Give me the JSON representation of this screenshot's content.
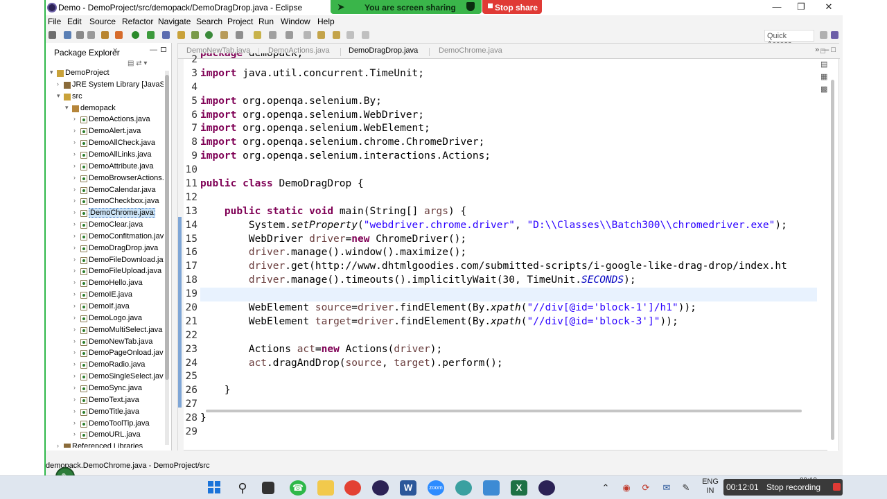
{
  "window": {
    "title": "Demo - DemoProject/src/demopack/DemoDragDrop.java - Eclipse"
  },
  "sharing": {
    "message": "You are screen sharing",
    "stop_label": "Stop share"
  },
  "menu": [
    "File",
    "Edit",
    "Source",
    "Refactor",
    "Navigate",
    "Search",
    "Project",
    "Run",
    "Window",
    "Help"
  ],
  "toolbar": {
    "quick_access": "Quick Access"
  },
  "package_explorer": {
    "title": "Package Explorer",
    "tree": [
      {
        "label": "DemoProject",
        "level": 0,
        "kind": "project"
      },
      {
        "label": "JRE System Library [JavaSE-",
        "level": 1,
        "kind": "library"
      },
      {
        "label": "src",
        "level": 1,
        "kind": "folder"
      },
      {
        "label": "demopack",
        "level": 2,
        "kind": "package"
      },
      {
        "label": "DemoActions.java",
        "level": 3,
        "kind": "file"
      },
      {
        "label": "DemoAlert.java",
        "level": 3,
        "kind": "file"
      },
      {
        "label": "DemoAllCheck.java",
        "level": 3,
        "kind": "file"
      },
      {
        "label": "DemoAllLinks.java",
        "level": 3,
        "kind": "file"
      },
      {
        "label": "DemoAttribute.java",
        "level": 3,
        "kind": "file"
      },
      {
        "label": "DemoBrowserActions.j",
        "level": 3,
        "kind": "file"
      },
      {
        "label": "DemoCalendar.java",
        "level": 3,
        "kind": "file"
      },
      {
        "label": "DemoCheckbox.java",
        "level": 3,
        "kind": "file"
      },
      {
        "label": "DemoChrome.java",
        "level": 3,
        "kind": "file",
        "selected": true
      },
      {
        "label": "DemoClear.java",
        "level": 3,
        "kind": "file"
      },
      {
        "label": "DemoConfitmation.java",
        "level": 3,
        "kind": "file"
      },
      {
        "label": "DemoDragDrop.java",
        "level": 3,
        "kind": "file"
      },
      {
        "label": "DemoFileDownload.jav",
        "level": 3,
        "kind": "file"
      },
      {
        "label": "DemoFileUpload.java",
        "level": 3,
        "kind": "file"
      },
      {
        "label": "DemoHello.java",
        "level": 3,
        "kind": "file"
      },
      {
        "label": "DemoIE.java",
        "level": 3,
        "kind": "file"
      },
      {
        "label": "DemoIf.java",
        "level": 3,
        "kind": "file"
      },
      {
        "label": "DemoLogo.java",
        "level": 3,
        "kind": "file"
      },
      {
        "label": "DemoMultiSelect.java",
        "level": 3,
        "kind": "file"
      },
      {
        "label": "DemoNewTab.java",
        "level": 3,
        "kind": "file"
      },
      {
        "label": "DemoPageOnload.java",
        "level": 3,
        "kind": "file"
      },
      {
        "label": "DemoRadio.java",
        "level": 3,
        "kind": "file"
      },
      {
        "label": "DemoSingleSelect.java",
        "level": 3,
        "kind": "file"
      },
      {
        "label": "DemoSync.java",
        "level": 3,
        "kind": "file"
      },
      {
        "label": "DemoText.java",
        "level": 3,
        "kind": "file"
      },
      {
        "label": "DemoTitle.java",
        "level": 3,
        "kind": "file"
      },
      {
        "label": "DemoToolTip.java",
        "level": 3,
        "kind": "file"
      },
      {
        "label": "DemoURL.java",
        "level": 3,
        "kind": "file"
      },
      {
        "label": "Referenced Libraries",
        "level": 1,
        "kind": "library"
      }
    ]
  },
  "editor": {
    "tabs": [
      {
        "label": "DemoNewTab.java",
        "active": false
      },
      {
        "label": "DemoActions.java",
        "active": false
      },
      {
        "label": "DemoDragDrop.java",
        "active": true
      },
      {
        "label": "DemoChrome.java",
        "active": false
      }
    ],
    "line_numbers": [
      "2",
      "3",
      "4",
      "5",
      "6",
      "7",
      "8",
      "9",
      "10",
      "11",
      "12",
      "13",
      "14",
      "15",
      "16",
      "17",
      "18",
      "19",
      "20",
      "21",
      "22",
      "23",
      "24",
      "25",
      "26",
      "27",
      "28",
      "29"
    ],
    "code_lines": [
      "package demopack;",
      "import java.util.concurrent.TimeUnit;",
      "",
      "import org.openqa.selenium.By;",
      "import org.openqa.selenium.WebDriver;",
      "import org.openqa.selenium.WebElement;",
      "import org.openqa.selenium.chrome.ChromeDriver;",
      "import org.openqa.selenium.interactions.Actions;",
      "",
      "public class DemoDragDrop {",
      "",
      "    public static void main(String[] args) {",
      "        System.setProperty(\"webdriver.chrome.driver\", \"D:\\\\Classes\\\\Batch300\\\\chromedriver.exe\");",
      "        WebDriver driver=new ChromeDriver();",
      "        driver.manage().window().maximize();",
      "        driver.get(\"http://www.dhtmlgoodies.com/submitted-scripts/i-google-like-drag-drop/index.ht",
      "        driver.manage().timeouts().implicitlyWait(30, TimeUnit.SECONDS);",
      "",
      "        WebElement source=driver.findElement(By.xpath(\"//div[@id='block-1']/h1\"));",
      "        WebElement target=driver.findElement(By.xpath(\"//div[@id='block-3']\"));",
      "",
      "        Actions act=new Actions(driver);",
      "        act.dragAndDrop(source, target).perform();",
      "",
      "    }",
      "",
      "}",
      ""
    ],
    "highlighted_line": "19"
  },
  "status": {
    "text": "demopack.DemoChrome.java - DemoProject/src"
  },
  "taskbar": {
    "language": "ENG",
    "region": "IN",
    "clock_partial": "09:19"
  },
  "recording": {
    "elapsed": "00:12:01",
    "stop_label": "Stop recording"
  }
}
